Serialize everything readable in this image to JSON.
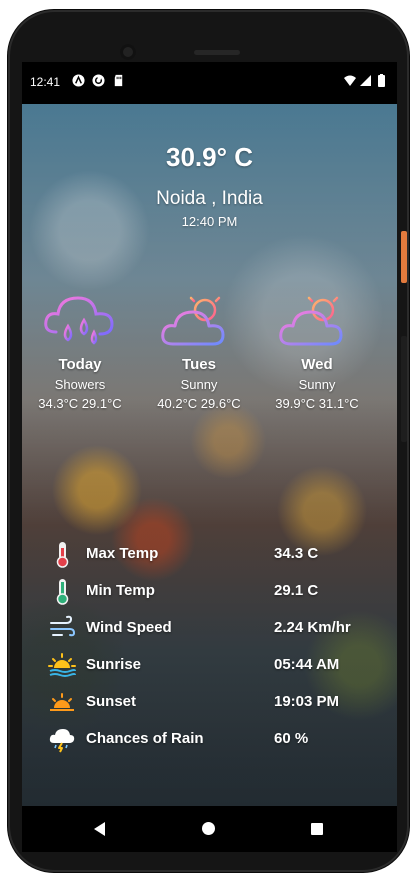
{
  "status_bar": {
    "time": "12:41",
    "left_icons": [
      "app-a-icon",
      "sync-icon",
      "sd-card-icon"
    ],
    "right_icons": [
      "wifi-icon",
      "cellular-icon",
      "battery-icon"
    ]
  },
  "current": {
    "temperature": "30.9° C",
    "location": "Noida ,  India",
    "time": "12:40 PM"
  },
  "forecast": [
    {
      "day": "Today",
      "condition": "Showers",
      "range": "34.3°C  29.1°C",
      "icon": "showers-icon"
    },
    {
      "day": "Tues",
      "condition": "Sunny",
      "range": "40.2°C  29.6°C",
      "icon": "partly-sunny-icon"
    },
    {
      "day": "Wed",
      "condition": "Sunny",
      "range": "39.9°C  31.1°C",
      "icon": "partly-sunny-icon"
    }
  ],
  "details": [
    {
      "icon": "thermometer-hot-icon",
      "label": "Max Temp",
      "value": "34.3 C"
    },
    {
      "icon": "thermometer-cold-icon",
      "label": "Min Temp",
      "value": "29.1 C"
    },
    {
      "icon": "wind-icon",
      "label": "Wind Speed",
      "value": "2.24 Km/hr"
    },
    {
      "icon": "sunrise-icon",
      "label": "Sunrise",
      "value": "05:44 AM"
    },
    {
      "icon": "sunset-icon",
      "label": "Sunset",
      "value": "19:03 PM"
    },
    {
      "icon": "rain-cloud-icon",
      "label": "Chances of Rain",
      "value": "60 %"
    }
  ],
  "nav": [
    "back-icon",
    "home-icon",
    "recents-icon"
  ],
  "colors": {
    "phone_frame": "#151515",
    "accent_button": "#e27a3d",
    "text": "#ffffff"
  }
}
